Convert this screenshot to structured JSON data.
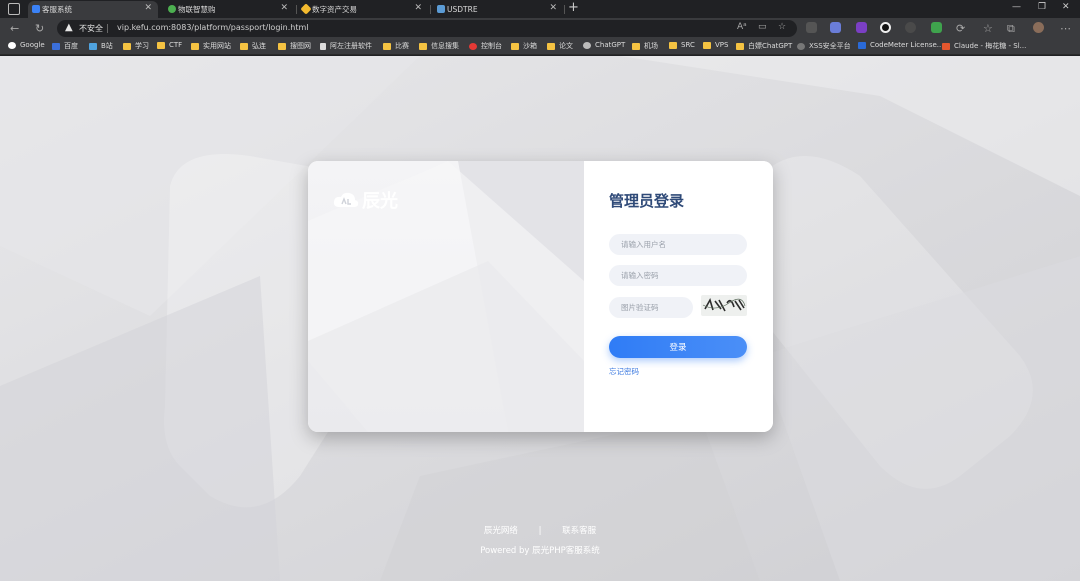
{
  "browser": {
    "tabs": [
      {
        "title": "客服系统",
        "active": true,
        "favicon_color": "#3b82f6"
      },
      {
        "title": "物联智慧购",
        "active": false,
        "favicon_color": "#4caf50"
      },
      {
        "title": "数字资产交易",
        "active": false,
        "favicon_color": "#f3ba2f"
      },
      {
        "title": "USDTRE",
        "active": false,
        "favicon_color": "#5b9bd5"
      }
    ],
    "security_label": "不安全",
    "url": "vip.kefu.com:8083/platform/passport/login.html",
    "bookmarks": [
      {
        "label": "Google",
        "icon": "google-icon"
      },
      {
        "label": "百度",
        "icon": "baidu-icon"
      },
      {
        "label": "B站",
        "icon": "bilibili-icon"
      },
      {
        "label": "学习",
        "icon": "folder-icon"
      },
      {
        "label": "CTF",
        "icon": "folder-icon"
      },
      {
        "label": "实用网站",
        "icon": "folder-icon"
      },
      {
        "label": "弘连",
        "icon": "folder-icon"
      },
      {
        "label": "搜图网",
        "icon": "folder-icon"
      },
      {
        "label": "阿左注册软件",
        "icon": "page-icon"
      },
      {
        "label": "比赛",
        "icon": "folder-icon"
      },
      {
        "label": "信息搜集",
        "icon": "folder-icon"
      },
      {
        "label": "控制台",
        "icon": "huawei-icon"
      },
      {
        "label": "沙箱",
        "icon": "folder-icon"
      },
      {
        "label": "论文",
        "icon": "folder-icon"
      },
      {
        "label": "ChatGPT",
        "icon": "chatgpt-icon"
      },
      {
        "label": "机场",
        "icon": "folder-icon"
      },
      {
        "label": "SRC",
        "icon": "folder-icon"
      },
      {
        "label": "VPS",
        "icon": "folder-icon"
      },
      {
        "label": "白嫖ChatGPT",
        "icon": "folder-icon"
      },
      {
        "label": "XSS安全平台",
        "icon": "xss-icon"
      },
      {
        "label": "CodeMeter License...",
        "icon": "codemeter-icon"
      },
      {
        "label": "Claude - 梅花糖 - Sl...",
        "icon": "claude-icon"
      }
    ]
  },
  "login": {
    "brand": "辰光",
    "title": "管理员登录",
    "username_placeholder": "请输入用户名",
    "password_placeholder": "请输入密码",
    "captcha_placeholder": "图片验证码",
    "submit_label": "登录",
    "forgot_label": "忘记密码",
    "accent_color": "#2f7cf6",
    "title_color": "#2f4a78"
  },
  "footer": {
    "link1": "辰光网络",
    "separator": "|",
    "link2": "联系客服",
    "powered": "Powered by 辰光PHP客服系统"
  }
}
